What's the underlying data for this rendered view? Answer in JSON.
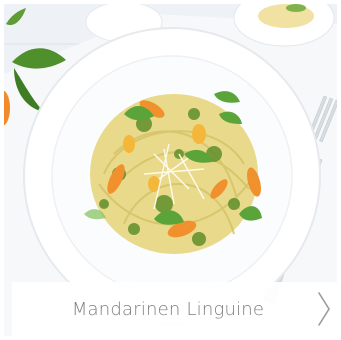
{
  "recipe_card": {
    "title": "Mandarinen Linguine",
    "image_alt": "Mandarinen Linguine",
    "chevron_icon": "chevron-right-icon"
  },
  "colors": {
    "caption_text": "#7d7d7d",
    "caption_bg": "#ffffff",
    "chevron": "#9a9a9a"
  }
}
